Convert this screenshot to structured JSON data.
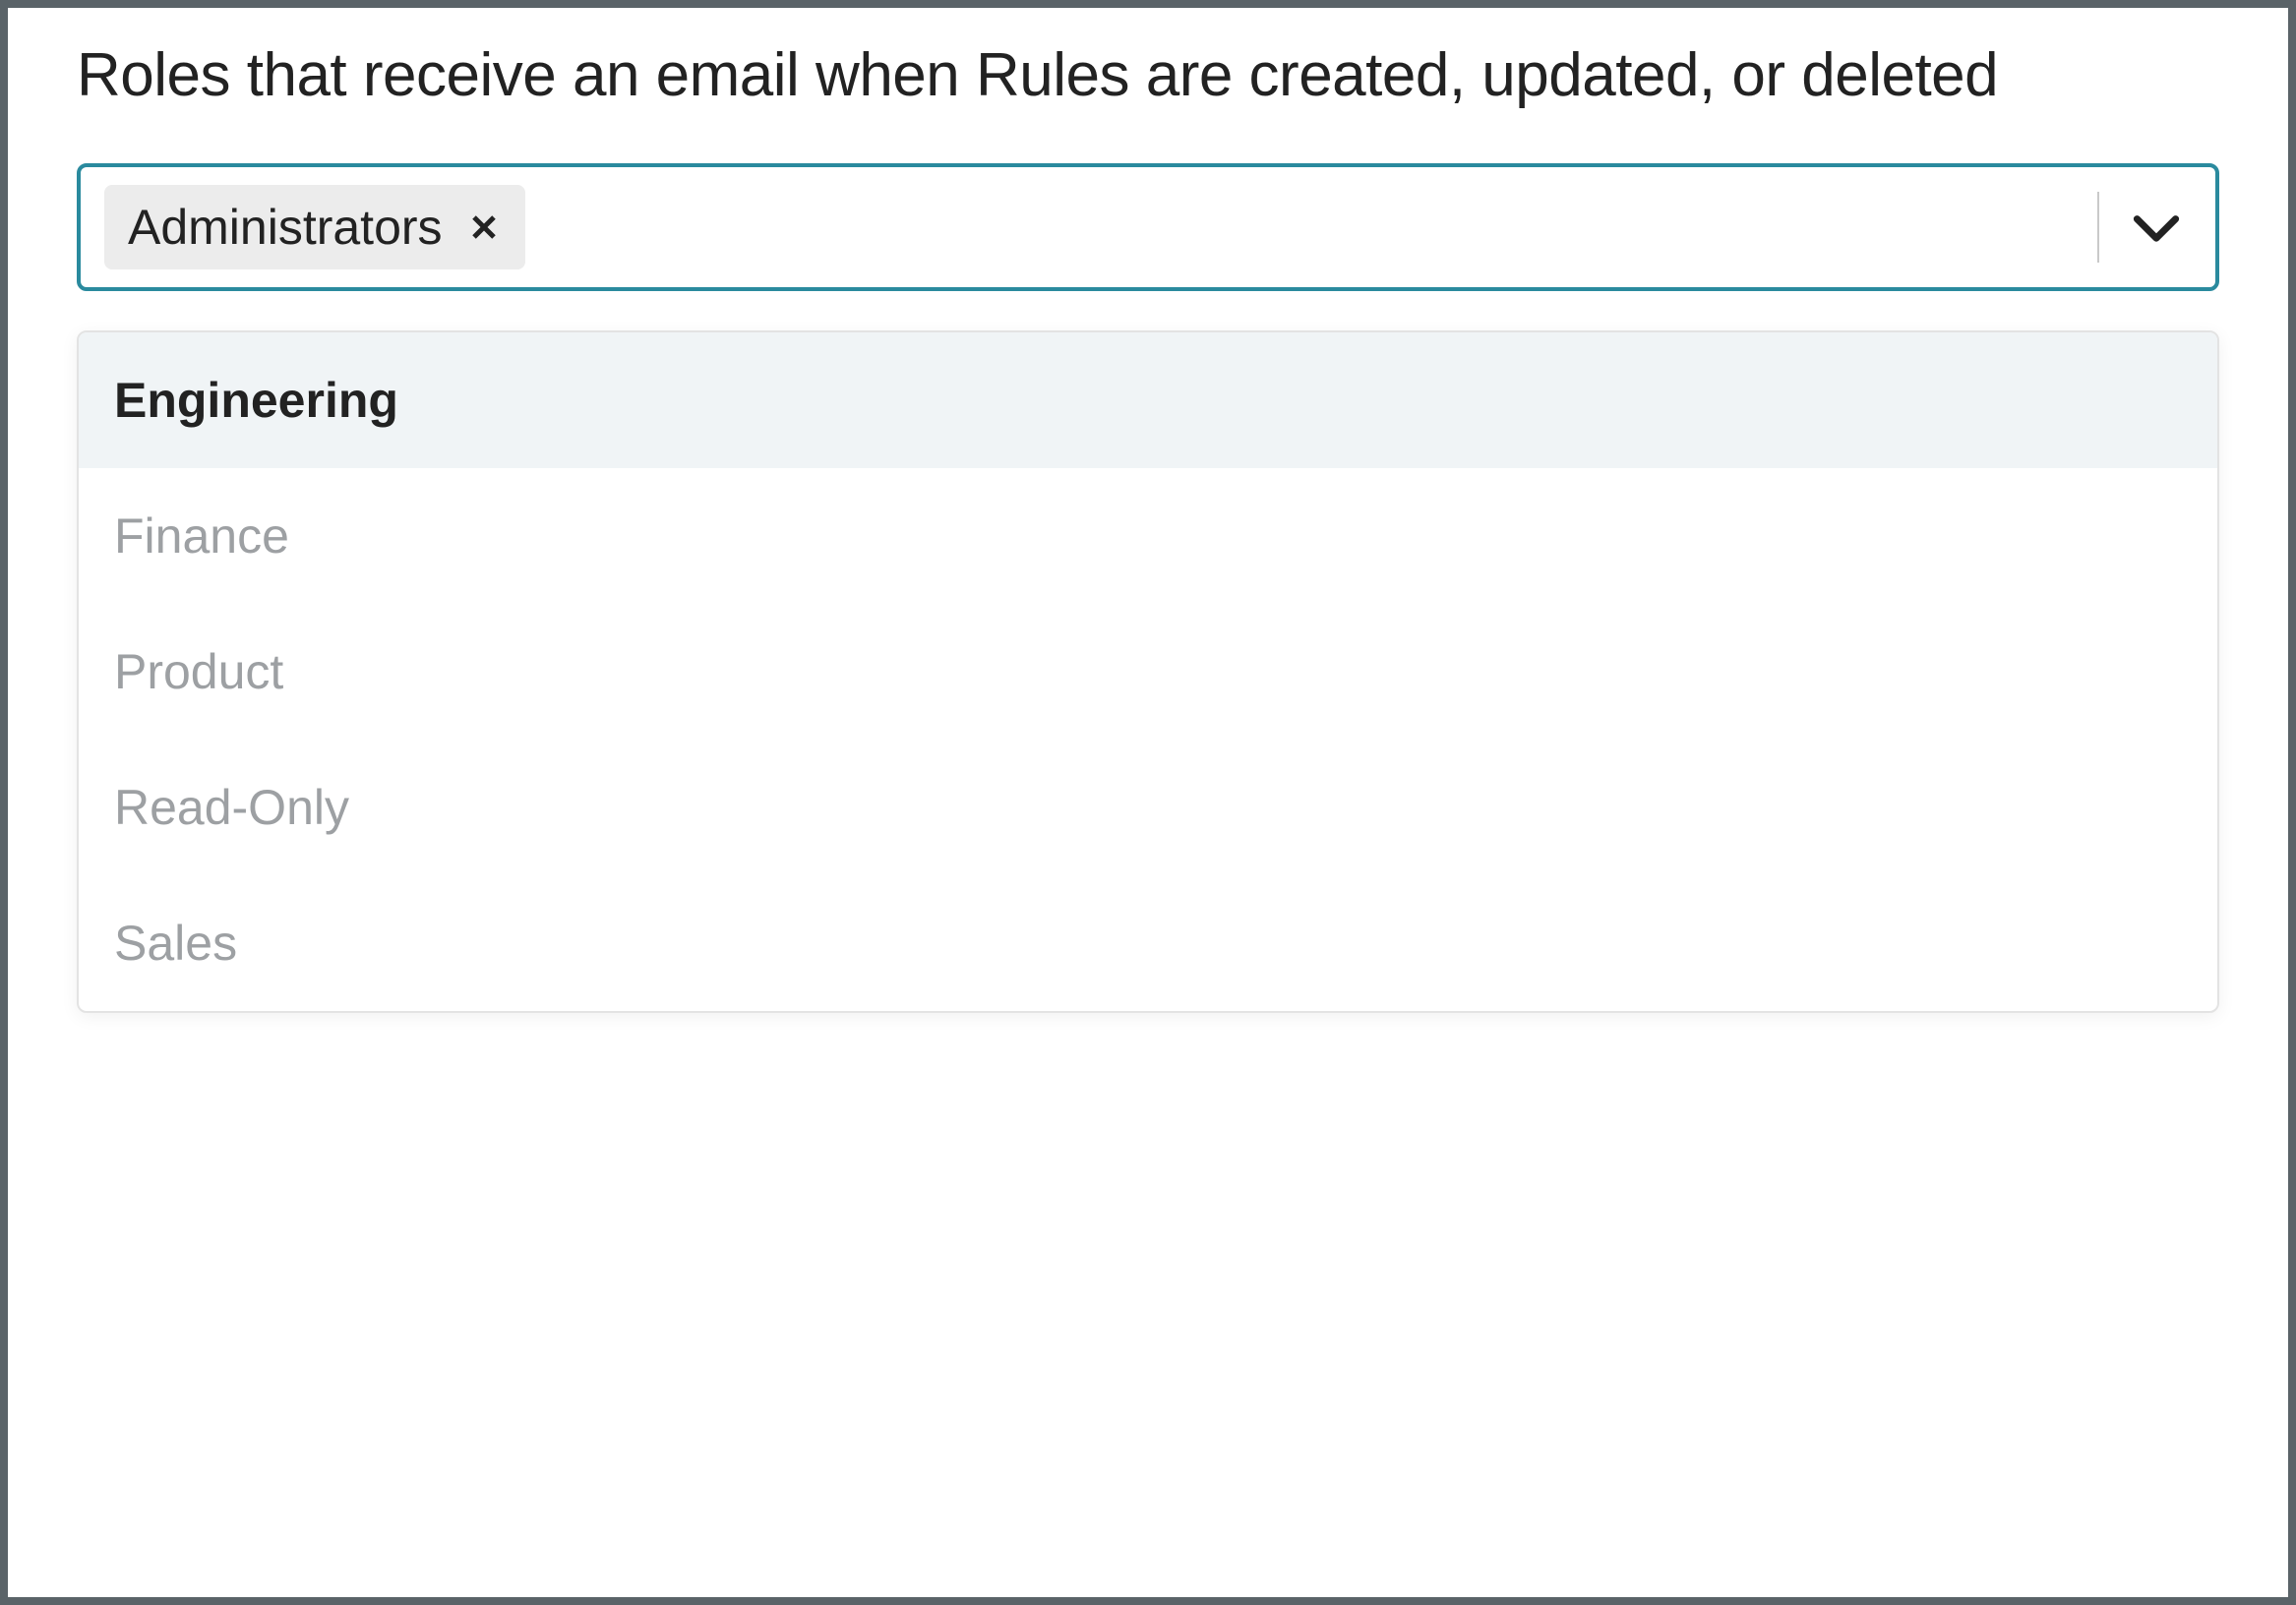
{
  "heading": "Roles that receive an email when Rules are created, updated, or deleted",
  "select": {
    "selected_chips": [
      {
        "label": "Administrators"
      }
    ]
  },
  "dropdown": {
    "options": [
      {
        "label": "Engineering",
        "highlighted": true
      },
      {
        "label": "Finance",
        "highlighted": false
      },
      {
        "label": "Product",
        "highlighted": false
      },
      {
        "label": "Read-Only",
        "highlighted": false
      },
      {
        "label": "Sales",
        "highlighted": false
      }
    ]
  }
}
